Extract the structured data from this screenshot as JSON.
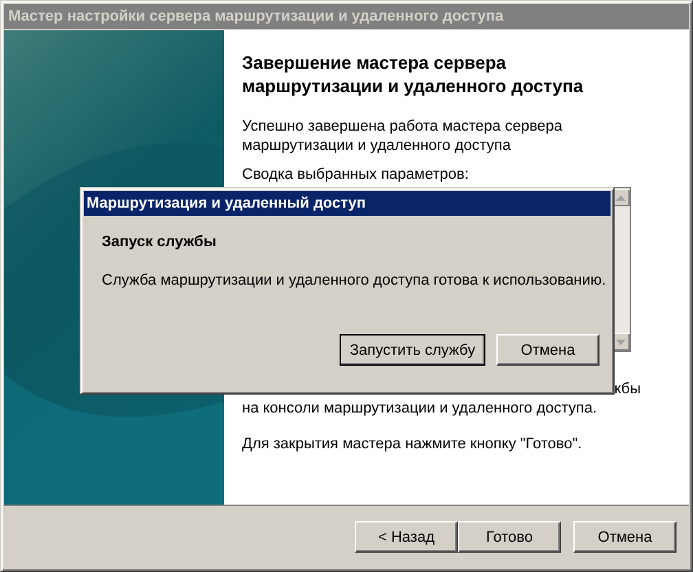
{
  "window": {
    "title": "Мастер настройки сервера маршрутизации и удаленного доступа",
    "active": false
  },
  "page": {
    "heading": "Завершение мастера сервера маршрутизации и удаленного доступа",
    "intro": "Успешно завершена работа мастера сервера маршрутизации и удаленного доступа",
    "summary_label": "Сводка выбранных параметров:",
    "partial_line": "кбы",
    "console_line": "на консоли маршрутизации и удаленного доступа.",
    "close_hint": "Для закрытия мастера нажмите кнопку \"Готово\"."
  },
  "buttons": [
    {
      "label": "< Назад",
      "kind": "back"
    },
    {
      "label": "Готово",
      "kind": "finish"
    },
    {
      "label": "Отмена",
      "kind": "cancel"
    }
  ],
  "dialog": {
    "title": "Маршрутизация и удаленный доступ",
    "heading": "Запуск службы",
    "message": "Служба маршрутизации и удаленного доступа готова к использованию.",
    "buttons": [
      {
        "label": "Запустить службу",
        "default": true
      },
      {
        "label": "Отмена",
        "default": false
      }
    ]
  }
}
